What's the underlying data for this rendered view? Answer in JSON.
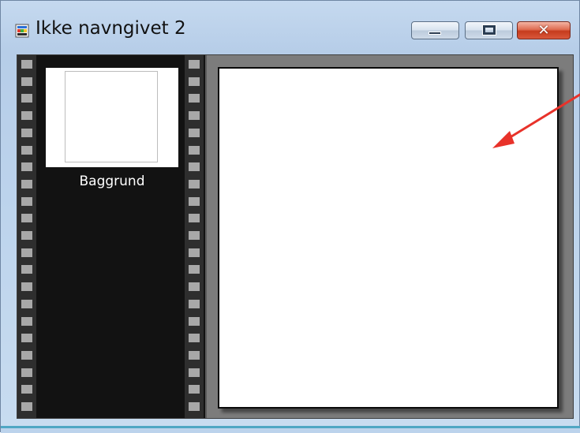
{
  "window": {
    "title": "Ikke navngivet 2",
    "app_icon": "image-document-icon",
    "controls": {
      "minimize_icon": "minimize-icon",
      "maximize_icon": "maximize-icon",
      "close_icon": "close-icon",
      "close_glyph": "✕",
      "close_color": "#c63b1d"
    }
  },
  "layers_panel": {
    "layers": [
      {
        "label": "Baggrund"
      }
    ]
  },
  "canvas": {
    "background": "#ffffff"
  },
  "annotation": {
    "arrow_color": "#e8322a"
  }
}
